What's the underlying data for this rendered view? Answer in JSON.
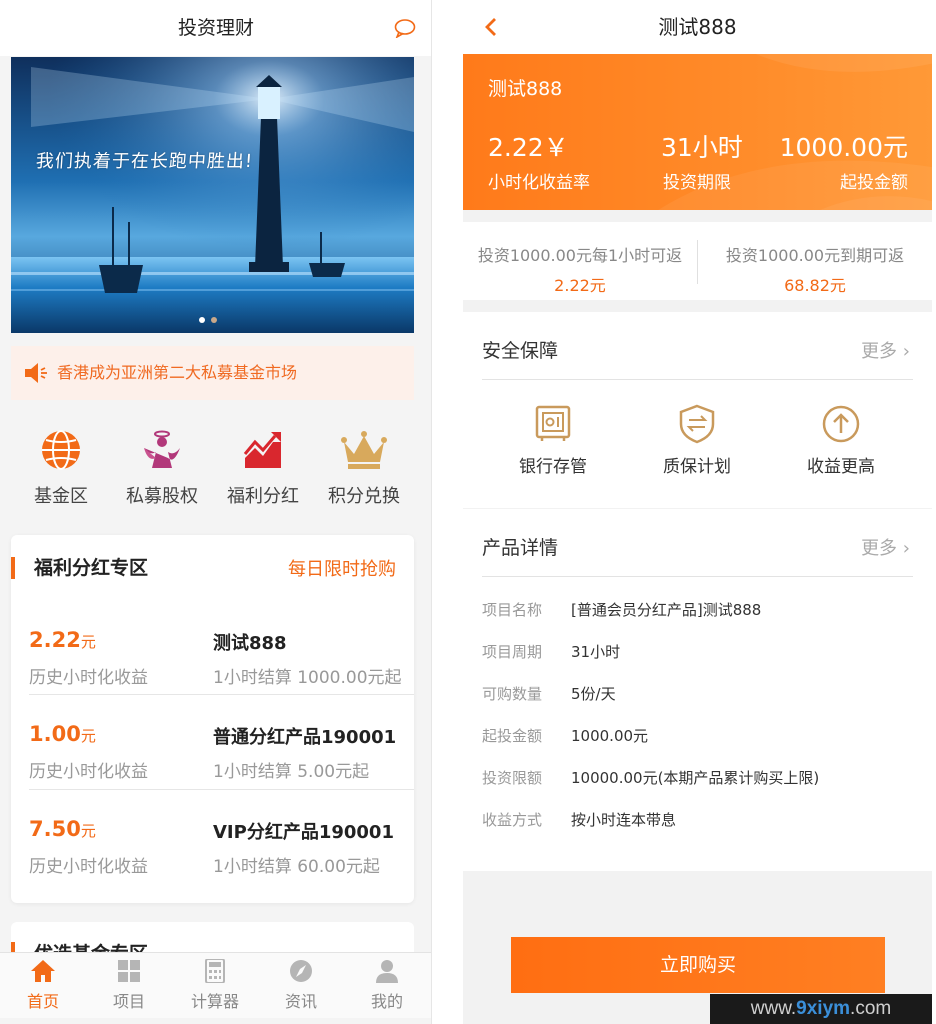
{
  "left": {
    "title": "投资理财",
    "banner_text": "我们执着于在长跑中胜出!",
    "notice": "香港成为亚洲第二大私募基金市场",
    "menu": [
      {
        "label": "基金区",
        "icon": "globe-icon"
      },
      {
        "label": "私募股权",
        "icon": "angel-icon"
      },
      {
        "label": "福利分红",
        "icon": "trend-chart-icon"
      },
      {
        "label": "积分兑换",
        "icon": "crown-icon"
      }
    ],
    "section": {
      "title": "福利分红专区",
      "more": "每日限时抢购",
      "products": [
        {
          "rate": "2.22",
          "unit": "元",
          "rate_label": "历史小时化收益",
          "name": "测试888",
          "desc": "1小时结算 1000.00元起"
        },
        {
          "rate": "1.00",
          "unit": "元",
          "rate_label": "历史小时化收益",
          "name": "普通分红产品190001",
          "desc": "1小时结算 5.00元起"
        },
        {
          "rate": "7.50",
          "unit": "元",
          "rate_label": "历史小时化收益",
          "name": "VIP分红产品190001",
          "desc": "1小时结算 60.00元起"
        }
      ]
    },
    "section2_title": "优选基金专区",
    "tabs": [
      {
        "label": "首页",
        "icon": "home-icon"
      },
      {
        "label": "项目",
        "icon": "grid-icon"
      },
      {
        "label": "计算器",
        "icon": "calculator-icon"
      },
      {
        "label": "资讯",
        "icon": "compass-icon"
      },
      {
        "label": "我的",
        "icon": "user-icon"
      }
    ]
  },
  "right": {
    "title": "测试888",
    "hero": {
      "name": "测试888",
      "rate": "2.22￥",
      "rate_label": "小时化收益率",
      "period": "31小时",
      "period_label": "投资期限",
      "min": "1000.00元",
      "min_label": "起投金额"
    },
    "returns": [
      {
        "text": "投资1000.00元每1小时可返",
        "value": "2.22元"
      },
      {
        "text": "投资1000.00元到期可返",
        "value": "68.82元"
      }
    ],
    "security": {
      "title": "安全保障",
      "more": "更多",
      "features": [
        {
          "label": "银行存管",
          "icon": "safe-icon"
        },
        {
          "label": "质保计划",
          "icon": "shield-icon"
        },
        {
          "label": "收益更高",
          "icon": "arrow-up-icon"
        }
      ]
    },
    "details": {
      "title": "产品详情",
      "more": "更多",
      "rows": [
        {
          "k": "项目名称",
          "v": "[普通会员分红产品]测试888"
        },
        {
          "k": "项目周期",
          "v": "31小时"
        },
        {
          "k": "可购数量",
          "v": "5份/天"
        },
        {
          "k": "起投金额",
          "v": "1000.00元"
        },
        {
          "k": "投资限额",
          "v": "10000.00元(本期产品累计购买上限)"
        },
        {
          "k": "收益方式",
          "v": "按小时连本带息"
        }
      ]
    },
    "buy_label": "立即购买",
    "watermark_a": "www.",
    "watermark_b": "9xiym",
    "watermark_c": ".com"
  },
  "colors": {
    "accent": "#f26a17",
    "hero": "#ff8a28",
    "banner_sky": "#1f6fb2"
  }
}
